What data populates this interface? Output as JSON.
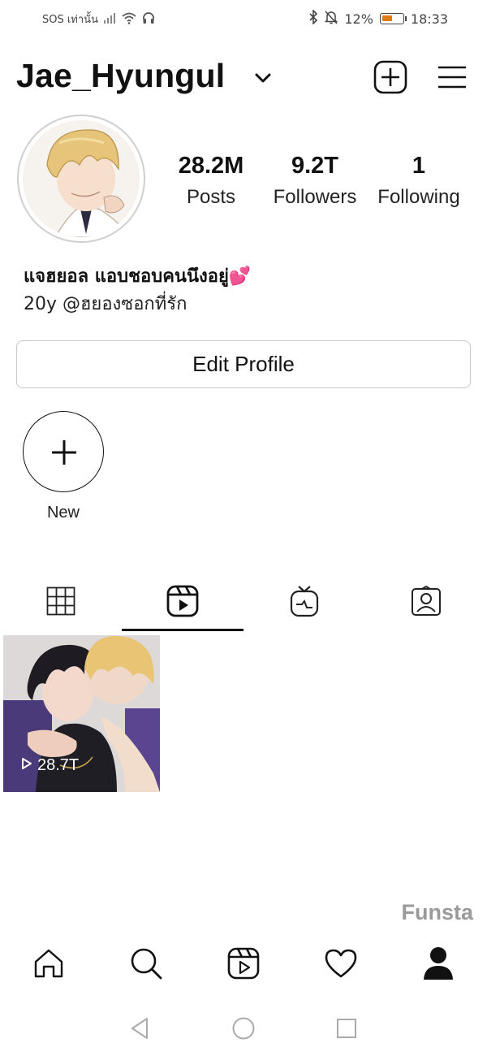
{
  "status_bar": {
    "carrier": "SOS เท่านั้น",
    "battery_percent": "12%",
    "time": "18:33",
    "icons": [
      "signal-icon",
      "wifi-icon",
      "headphone-icon",
      "bluetooth-icon",
      "mute-icon",
      "battery-icon"
    ],
    "battery_level": 0.12
  },
  "header": {
    "username": "Jae_Hyungul"
  },
  "profile": {
    "stats": [
      {
        "value": "28.2M",
        "label": "Posts"
      },
      {
        "value": "9.2T",
        "label": "Followers"
      },
      {
        "value": "1",
        "label": "Following"
      }
    ],
    "bio_name": "แจฮยอล แอบชอบคนนึงอยู่💕",
    "bio_line": "20y @ฮยองซอกที่รัก",
    "edit_button": "Edit Profile"
  },
  "highlights": {
    "new_label": "New"
  },
  "tabs": [
    {
      "icon": "grid-icon",
      "active": false
    },
    {
      "icon": "reels-icon",
      "active": true
    },
    {
      "icon": "igtv-icon",
      "active": false
    },
    {
      "icon": "tagged-icon",
      "active": false
    }
  ],
  "posts": [
    {
      "views": "28.7T"
    }
  ],
  "watermark": "Funsta",
  "bottom_nav": [
    "home-icon",
    "search-icon",
    "reels-icon",
    "heart-icon",
    "profile-icon"
  ],
  "system_nav": [
    "back-icon",
    "home-circle-icon",
    "recents-icon"
  ]
}
